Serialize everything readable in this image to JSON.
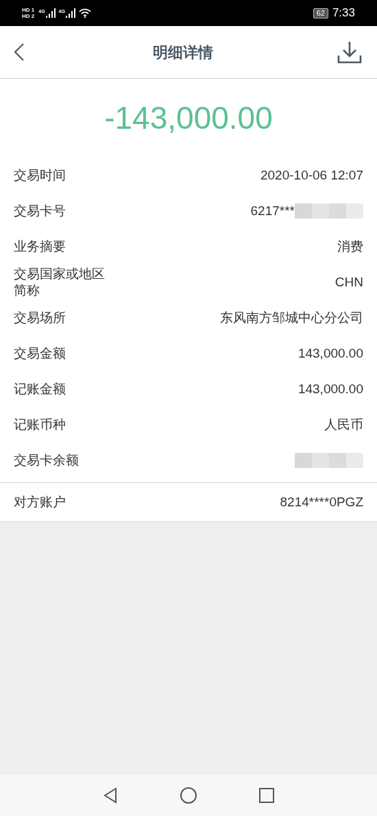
{
  "status_bar": {
    "sims": [
      {
        "label": "HD",
        "slot": "1"
      },
      {
        "label": "HD",
        "slot": "2"
      }
    ],
    "networks": [
      "4G",
      "4G"
    ],
    "battery": "62",
    "time": "7:33"
  },
  "header": {
    "title": "明细详情"
  },
  "amount": "-143,000.00",
  "details": [
    {
      "label": "交易时间",
      "value": "2020-10-06 12:07",
      "masked": false
    },
    {
      "label": "交易卡号",
      "value": "6217***",
      "masked": true
    },
    {
      "label": "业务摘要",
      "value": "消费",
      "masked": false
    },
    {
      "label": "交易国家或地区简称",
      "value": "CHN",
      "masked": false
    },
    {
      "label": "交易场所",
      "value": "东风南方邹城中心分公司",
      "masked": false
    },
    {
      "label": "交易金额",
      "value": "143,000.00",
      "masked": false
    },
    {
      "label": "记账金额",
      "value": "143,000.00",
      "masked": false
    },
    {
      "label": "记账币种",
      "value": "人民币",
      "masked": false
    },
    {
      "label": "交易卡余额",
      "masked": true
    }
  ],
  "counterparty": {
    "label": "对方账户",
    "value": "8214****0PGZ"
  }
}
